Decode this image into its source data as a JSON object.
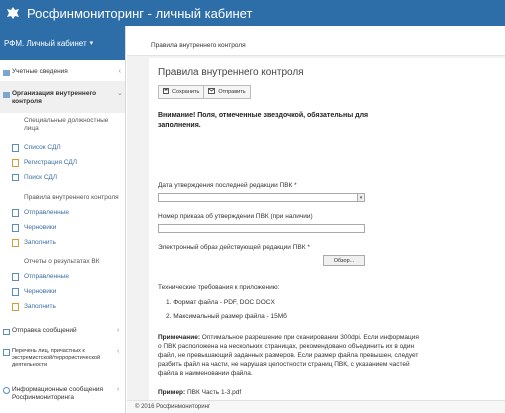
{
  "header": {
    "title": "Росфинмониторинг - личный кабинет"
  },
  "sidebar": {
    "cabinet_label": "РФМ. Личный кабинет",
    "sections": [
      {
        "label": "Учетные сведения"
      },
      {
        "label": "Организация внутреннего контроля"
      },
      {
        "label": "Отправка сообщений"
      },
      {
        "label": "Перечень лиц, причастных к экстремистской/террористической деятельности"
      },
      {
        "label": "Информационные сообщения Росфинмониторинга"
      }
    ],
    "groups": [
      {
        "label": "Специальные должностные лица"
      },
      {
        "label": "Правила внутреннего контроля"
      },
      {
        "label": "Отчеты о результатах ВК"
      }
    ],
    "links": [
      {
        "label": "Список СДЛ"
      },
      {
        "label": "Регистрация СДЛ"
      },
      {
        "label": "Поиск СДЛ"
      },
      {
        "label": "Отправленные"
      },
      {
        "label": "Черновики"
      },
      {
        "label": "Заполнить"
      },
      {
        "label": "Отправленные"
      },
      {
        "label": "Черновики"
      },
      {
        "label": "Заполнить"
      }
    ]
  },
  "breadcrumb": "Правила внутреннего контроля",
  "form": {
    "title": "Правила внутреннего контроля",
    "save_label": "Сохранить",
    "send_label": "Отправить",
    "warning": "Внимание! Поля, отмеченные звездочкой, обязательны для заполнения.",
    "date_label": "Дата утверждения последней редакции ПВК *",
    "order_label": "Номер приказа об утверждении ПВК (при наличии)",
    "file_label": "Электронный образ действующей редакции ПВК *",
    "browse_label": "Обзор...",
    "req_title": "Технические требования к приложению:",
    "req_items": [
      "1.  Формат файла - PDF, DOC DOCX",
      "2.  Максимальный размер файла - 15Мб"
    ],
    "note_bold": "Примечание:",
    "note_text": " Оптимальное разрешение при сканировании 300dpi. Если информация о ПВК расположена на нескольких страницах, рекомендовано объединить их в один файл, не превышающий заданных размеров. Если размер файла превышен, следует разбить файл на части, не нарушая целостности страниц ПВК, с указанием частей файла в наименовании файла.",
    "example_bold": "Пример:",
    "example_text": " ПВК Часть 1-3.pdf"
  },
  "footer": {
    "copyright": "© 2016 Росфинмониторинг"
  },
  "colors": {
    "brand_blue": "#2d6ea8",
    "link_blue": "#3a6ea5"
  },
  "icons": [
    "emblem-icon",
    "folder-icon",
    "document-icon",
    "edit-icon",
    "save-icon",
    "send-icon"
  ]
}
